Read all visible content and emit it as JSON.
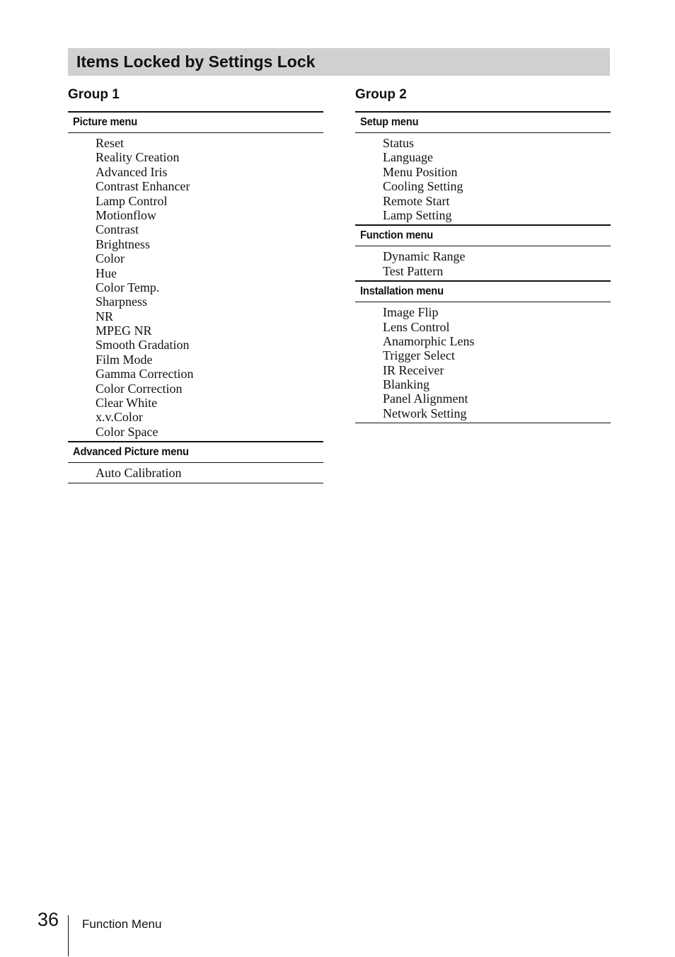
{
  "page_title": "Items Locked by Settings Lock",
  "groups": [
    {
      "title": "Group 1",
      "sections": [
        {
          "heading": "Picture menu",
          "items": [
            "Reset",
            "Reality Creation",
            "Advanced Iris",
            "Contrast Enhancer",
            "Lamp Control",
            "Motionflow",
            "Contrast",
            "Brightness",
            "Color",
            "Hue",
            "Color Temp.",
            "Sharpness",
            "NR",
            "MPEG NR",
            "Smooth Gradation",
            "Film Mode",
            "Gamma Correction",
            "Color Correction",
            "Clear White",
            "x.v.Color",
            "Color Space"
          ]
        },
        {
          "heading": "Advanced Picture menu",
          "items": [
            "Auto Calibration"
          ]
        }
      ]
    },
    {
      "title": "Group 2",
      "sections": [
        {
          "heading": "Setup menu",
          "items": [
            "Status",
            "Language",
            "Menu Position",
            "Cooling Setting",
            "Remote Start",
            "Lamp Setting"
          ]
        },
        {
          "heading": "Function menu",
          "items": [
            "Dynamic Range",
            "Test Pattern"
          ]
        },
        {
          "heading": "Installation menu",
          "items": [
            "Image Flip",
            "Lens Control",
            "Anamorphic Lens",
            "Trigger Select",
            "IR Receiver",
            "Blanking",
            "Panel Alignment",
            "Network Setting"
          ]
        }
      ]
    }
  ],
  "footer": {
    "page_number": "36",
    "section_label": "Function Menu"
  }
}
